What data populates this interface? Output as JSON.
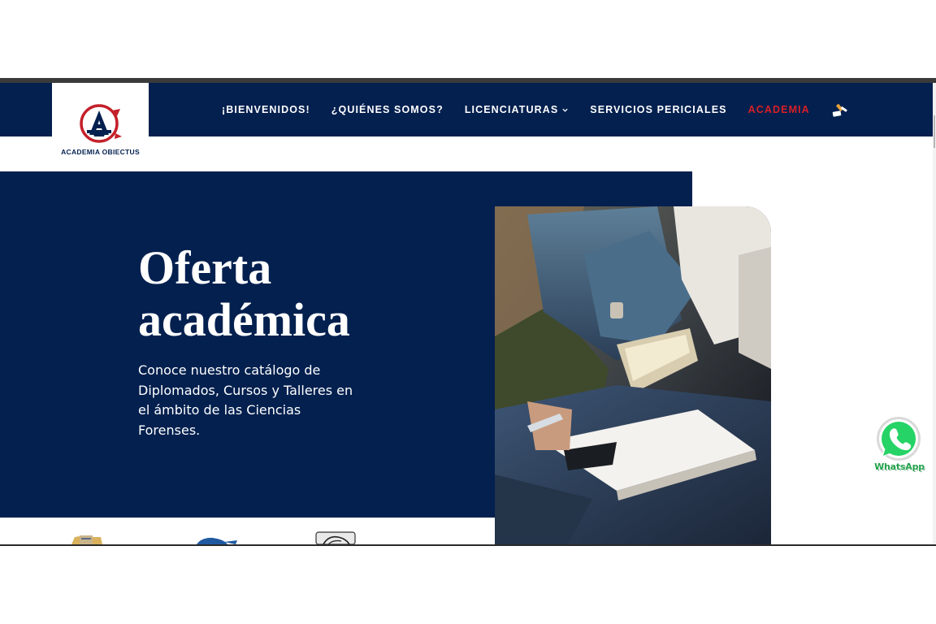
{
  "brand": {
    "logo_text": "ACADEMIA OBIECTUS",
    "colors": {
      "navy": "#03204f",
      "red": "#d81f26",
      "white": "#ffffff",
      "whatsapp_green": "#25d366"
    }
  },
  "nav": {
    "items": [
      {
        "label": "¡BIENVENIDOS!",
        "active": false
      },
      {
        "label": "¿QUIÉNES SOMOS?",
        "active": false
      },
      {
        "label": "LICENCIATURAS",
        "active": false,
        "has_dropdown": true
      },
      {
        "label": "SERVICIOS PERICIALES",
        "active": false
      },
      {
        "label": "ACADEMIA",
        "active": true
      }
    ],
    "extra_icon": "gavel-icon"
  },
  "hero": {
    "title_line1": "Oferta",
    "title_line2": "académica",
    "description": "Conoce nuestro catálogo de Diplomados, Cursos y Talleres en el ámbito de las Ciencias Forenses.",
    "image": "students-with-notebooks-photo"
  },
  "partners": {
    "logos": [
      "institution-seal-logo",
      "blue-emblem-logo",
      "gray-emblem-logo"
    ]
  },
  "whatsapp": {
    "label": "WhatsApp",
    "icon": "whatsapp-icon"
  }
}
